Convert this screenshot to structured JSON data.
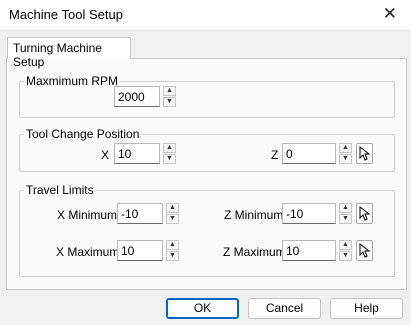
{
  "window": {
    "title": "Machine Tool Setup",
    "close_glyph": "✕"
  },
  "tab": {
    "label": "Turning Machine Setup"
  },
  "max_rpm": {
    "legend": "Maxmimum RPM",
    "value": "2000"
  },
  "tool_change": {
    "legend": "Tool Change Position",
    "x_label": "X",
    "x_value": "10",
    "z_label": "Z",
    "z_value": "0"
  },
  "travel_limits": {
    "legend": "Travel Limits",
    "x_min_label": "X Minimum",
    "x_min_value": "-10",
    "z_min_label": "Z Minimum",
    "z_min_value": "-10",
    "x_max_label": "X Maximum",
    "x_max_value": "10",
    "z_max_label": "Z Maximum",
    "z_max_value": "10"
  },
  "buttons": {
    "ok": "OK",
    "cancel": "Cancel",
    "help": "Help"
  },
  "colors": {
    "accent": "#0067c0",
    "background": "#f0f0f0",
    "panel": "#fafafa"
  },
  "icons": {
    "spin_up": "▲",
    "spin_down": "▼",
    "pick": "pointer-arrow-icon"
  }
}
